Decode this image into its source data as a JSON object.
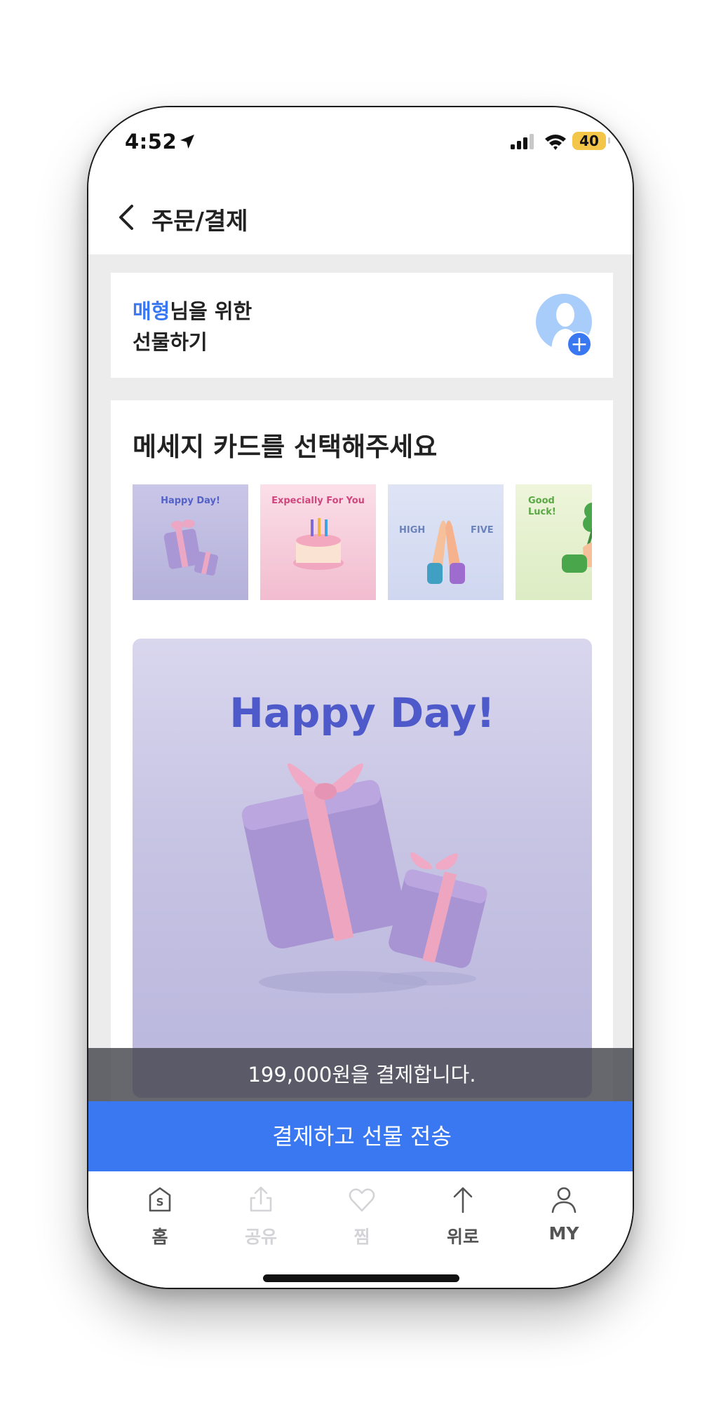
{
  "status_bar": {
    "time": "4:52",
    "battery": "40"
  },
  "header": {
    "title": "주문/결제"
  },
  "recipient": {
    "name": "매형",
    "line1_suffix": "님을 위한",
    "line2": "선물하기",
    "add_icon": "+"
  },
  "message_card": {
    "title": "메세지 카드를 선택해주세요",
    "thumbnails": [
      {
        "label": "Happy Day!"
      },
      {
        "label": "Expecially For You"
      },
      {
        "label_left": "HIGH",
        "label_right": "FIVE"
      },
      {
        "label_line1": "Good",
        "label_line2": "Luck!"
      }
    ],
    "preview_title": "Happy Day!"
  },
  "toast": "199,000원을 결제합니다.",
  "pay_button": "결제하고 선물 전송",
  "tabs": [
    {
      "label": "홈",
      "icon": "home-icon",
      "enabled": true
    },
    {
      "label": "공유",
      "icon": "share-icon",
      "enabled": false
    },
    {
      "label": "찜",
      "icon": "heart-icon",
      "enabled": false
    },
    {
      "label": "위로",
      "icon": "arrow-up-icon",
      "enabled": true
    },
    {
      "label": "MY",
      "icon": "person-icon",
      "enabled": true
    }
  ],
  "colors": {
    "accent": "#3a78f2",
    "preview_title": "#4e5ac9",
    "disabled": "#d4d4d8"
  }
}
